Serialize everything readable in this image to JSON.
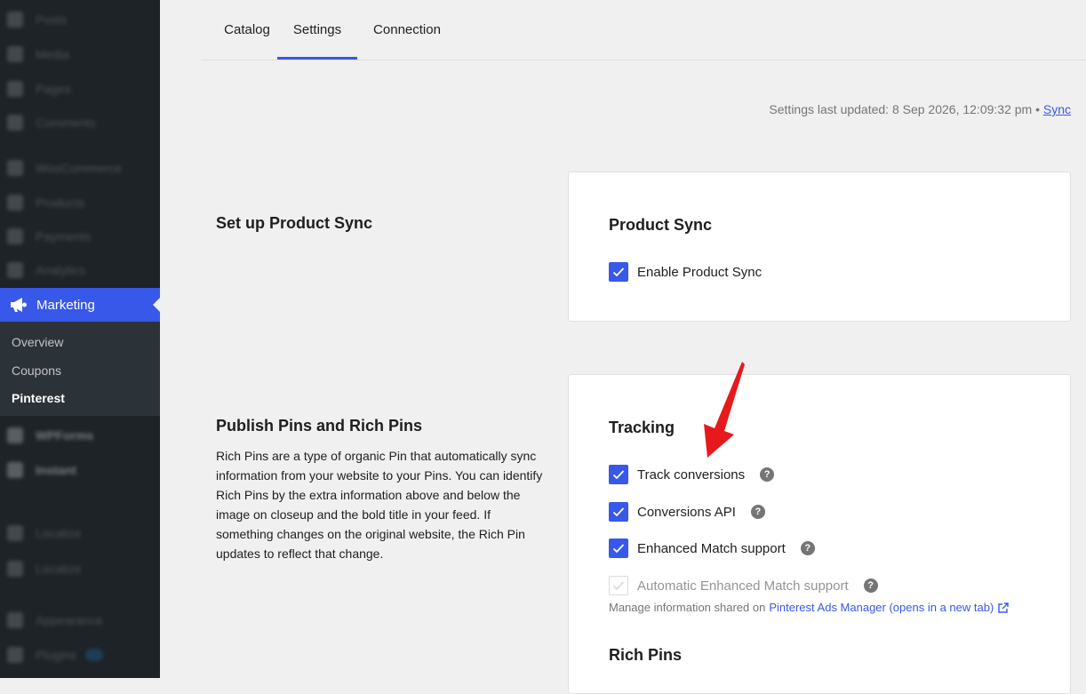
{
  "sidebar": {
    "blurred_items": [
      "Posts",
      "Media",
      "Pages",
      "Comments",
      "WooCommerce",
      "Products",
      "Payments",
      "Analytics",
      "WPForms",
      "Instant",
      "Localize",
      "Localize",
      "Appearance",
      "Plugins"
    ],
    "active_menu": {
      "label": "Marketing",
      "icon": "megaphone-icon"
    },
    "submenu": [
      {
        "label": "Overview",
        "current": false
      },
      {
        "label": "Coupons",
        "current": false
      },
      {
        "label": "Pinterest",
        "current": true
      }
    ]
  },
  "tabs": [
    {
      "label": "Catalog",
      "active": false
    },
    {
      "label": "Settings",
      "active": true
    },
    {
      "label": "Connection",
      "active": false
    }
  ],
  "status": {
    "text": "Settings last updated: 8 Sep 2026, 12:09:32 pm •",
    "sync_link": "Sync"
  },
  "sections": {
    "product_sync": {
      "title": "Set up Product Sync",
      "card_title": "Product Sync",
      "enable_label": "Enable Product Sync",
      "enable_checked": true
    },
    "publish": {
      "title": "Publish Pins and Rich Pins",
      "description": "Rich Pins are a type of organic Pin that automatically sync information from your website to your Pins. You can identify Rich Pins by the extra information above and below the image on closeup and the bold title in your feed. If something changes on the original website, the Rich Pin updates to reflect that change.",
      "tracking_title": "Tracking",
      "options": [
        {
          "label": "Track conversions",
          "checked": true,
          "disabled": false
        },
        {
          "label": "Conversions API",
          "checked": true,
          "disabled": false
        },
        {
          "label": "Enhanced Match support",
          "checked": true,
          "disabled": false
        },
        {
          "label": "Automatic Enhanced Match support",
          "checked": true,
          "disabled": true
        }
      ],
      "manage_text": "Manage information shared on",
      "manage_link": "Pinterest Ads Manager (opens in a new tab)",
      "rich_pins_title": "Rich Pins"
    }
  },
  "colors": {
    "accent": "#3858e9",
    "sidebar_bg": "#1d2327",
    "page_bg": "#f0f0f1",
    "annotation_arrow": "#e8191c"
  }
}
